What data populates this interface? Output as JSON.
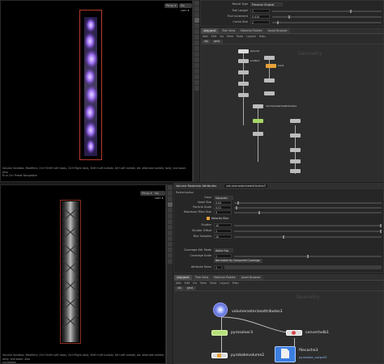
{
  "top_viewport": {
    "btn_persp": "Persp ▾",
    "btn_cam": "No cam ▾",
    "status_line1": "Volume Sandbox, Modifiers: Ctrl+Shift+Left tasks, Ctrl+Right dolly, Shift+Left tumble, Alt+Left tumble,   Alt: alternate tumble, dolly, and zoom.   Also",
    "status_line2": "M or Ctrl Preset Navigation"
  },
  "bottom_viewport": {
    "btn_persp": "Persp ▾",
    "btn_cam": "No cam ▾",
    "status_line1": "Volume Sandbox, Modifiers: Ctrl+Shift+Left tasks, Ctrl+Right dolly, Shift+Left tumble, Alt+Left tumble,   Alt: alternate tumble, dolly, and zoom.   Also",
    "status_line2": "navigation"
  },
  "top_params": {
    "rows": [
      {
        "label": "Result Type",
        "value": "Preserve Original"
      },
      {
        "label": "Trail Length",
        "value": "1"
      },
      {
        "label": "Trail Increment",
        "value": "0.414"
      },
      {
        "label": "Cache Size",
        "value": "2"
      }
    ]
  },
  "top_network": {
    "tabs": [
      "/obj/geo1",
      "Tree View",
      "Material Palette",
      "Asset Browser"
    ],
    "menu": [
      "Add",
      "Edit",
      "Go",
      "View",
      "Tools",
      "Layout",
      "Help"
    ],
    "path": [
      "obj",
      "geo1"
    ],
    "watermark": "Geometry",
    "nodes": [
      "sphere1",
      "scatter1",
      "attribnoise1",
      "pointvelocity1",
      "trail1",
      "volumerasterizeattributes1",
      "pyrosolver1",
      "convertvdb1",
      "filecache1",
      "pyrobakevolume1"
    ]
  },
  "param_panel": {
    "tab_type": "Volume Rasterize Attributes",
    "tab_name": "volumerasterizeattributes3",
    "section": "Rasterization",
    "rows": [
      {
        "label": "Class",
        "value": "Gaussian"
      },
      {
        "label": "Voxel Size",
        "value": "0.04"
      },
      {
        "label": "Particle Scale",
        "value": "0.01"
      },
      {
        "label": "Maximum Filter Size",
        "value": "3"
      }
    ],
    "velocity_label": "Velocity Blur",
    "velocity_rows": [
      {
        "label": "Shutter",
        "value": "10"
      },
      {
        "label": "Shutter Offset",
        "value": "1"
      },
      {
        "label": "Blur Samples",
        "value": "10"
      }
    ],
    "coverage_rows": [
      {
        "label": "Coverage Attr Mode",
        "value": "Alpha Fog"
      },
      {
        "label": "Coverage Scale",
        "value": "1"
      },
      {
        "label": "",
        "value": "Normalize by Computed Coverage"
      },
      {
        "label": "Attribute Rules",
        "value": "1"
      }
    ]
  },
  "bottom_network": {
    "tabs": [
      "/obj/geo1",
      "Tree View",
      "Material Palette",
      "Asset Browser"
    ],
    "menu": [
      "Add",
      "Edit",
      "Go",
      "View",
      "Tools",
      "Layout",
      "Help"
    ],
    "path": [
      "obj",
      "geo1"
    ],
    "watermark": "Geometry",
    "nodes": {
      "rasterize": "volumerasterizeattributes3",
      "pyrosolver": "pyrosolver3",
      "convertvdb": "convertvdb1",
      "filecache": "filecache3",
      "filecache_sub": "pyrobake_output3",
      "pyrobake": "pyrobakevolume2"
    }
  }
}
